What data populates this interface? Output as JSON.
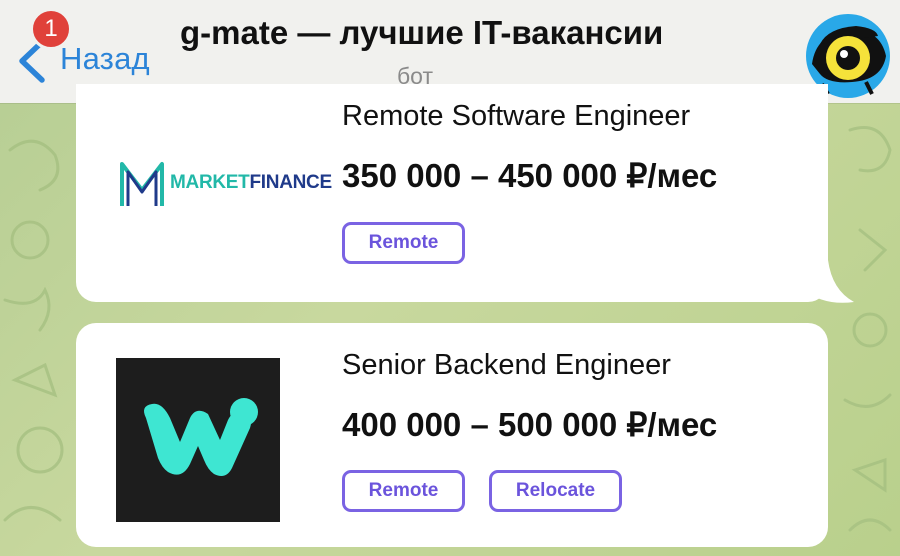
{
  "header": {
    "back_label": "Назад",
    "unread_badge": "1",
    "title": "g-mate — лучшие IT-вакансии",
    "subtitle": "бот",
    "back_icon": "chevron-left-icon",
    "avatar_icon": "eye-mascot-icon"
  },
  "jobs": [
    {
      "logo": {
        "prefix": "MARKET",
        "suffix": "FINANCE",
        "monogram": "M"
      },
      "title": "Remote Software Engineer",
      "salary": "350 000 – 450 000 ₽/мес",
      "tags": [
        "Remote"
      ]
    },
    {
      "logo": {
        "icon": "w-logo-icon"
      },
      "title": "Senior Backend Engineer",
      "salary": "400 000 – 500 000 ₽/мес",
      "tags": [
        "Remote",
        "Relocate"
      ]
    }
  ],
  "colors": {
    "accent": "#7a63e3",
    "link": "#2c84d8",
    "badge": "#e0413a",
    "mf_teal": "#22b8a8",
    "mf_navy": "#1f3a8a",
    "w_cyan": "#3ee6d2"
  }
}
